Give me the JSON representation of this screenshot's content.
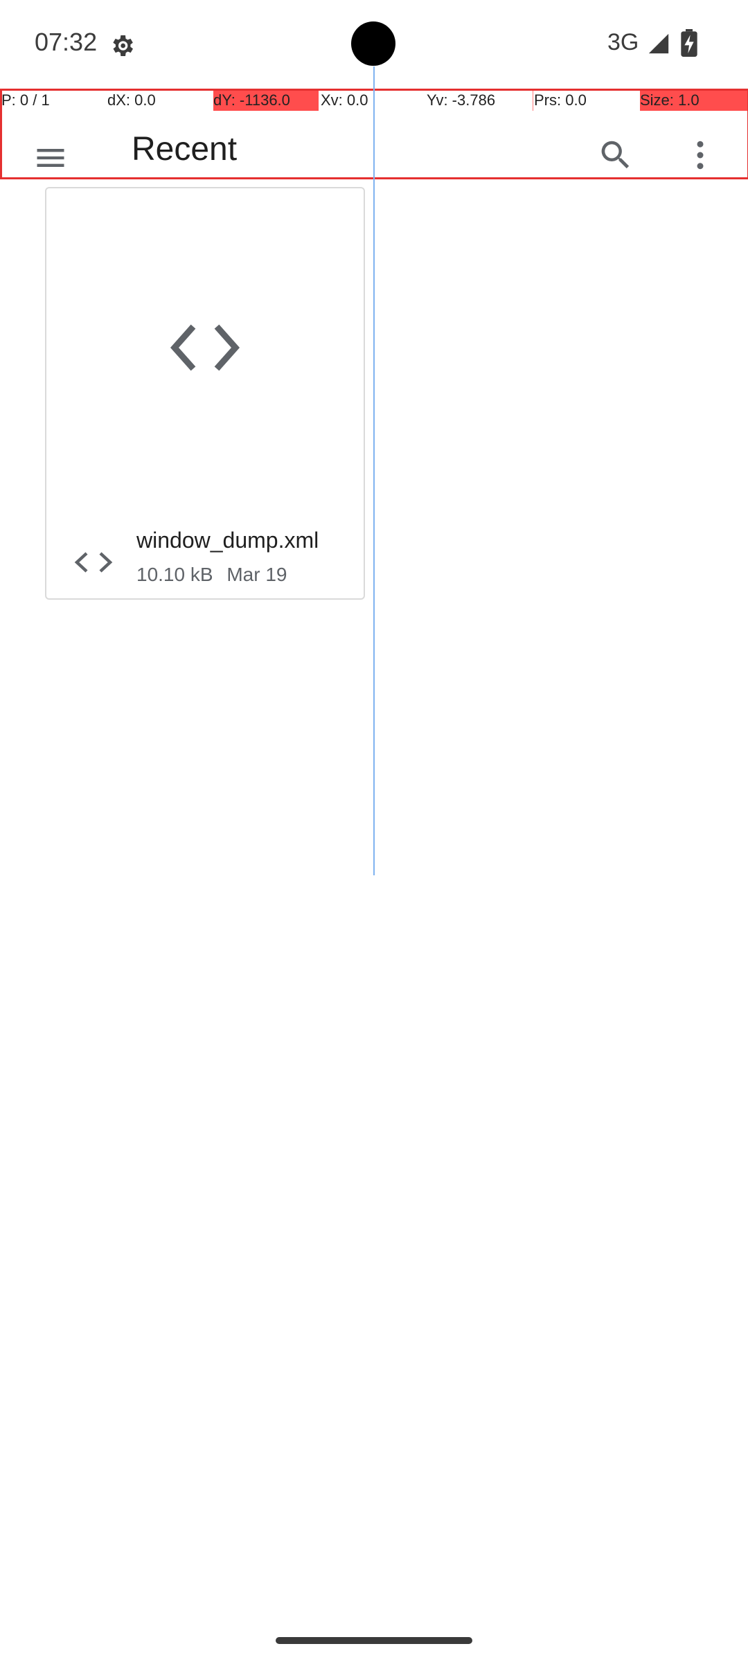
{
  "status_bar": {
    "time": "07:32",
    "network": "3G"
  },
  "debug_overlay": {
    "pointer": "P: 0 / 1",
    "dx": "dX: 0.0",
    "dy": "dY: -1136.0",
    "xv": "Xv: 0.0",
    "yv": "Yv: -3.786",
    "prs": "Prs: 0.0",
    "size": "Size: 1.0",
    "highlight_color": "#ff4d4d"
  },
  "app_bar": {
    "title": "Recent",
    "menu_icon": "hamburger-menu-icon",
    "search_icon": "search-icon",
    "more_icon": "more-vertical-icon"
  },
  "files": [
    {
      "name": "window_dump.xml",
      "size": "10.10 kB",
      "date": "Mar 19",
      "type_icon": "code-icon"
    }
  ],
  "colors": {
    "icon_gray": "#5f6368",
    "debug_red": "#e53030",
    "crosshair_blue": "#7fb3f0"
  }
}
